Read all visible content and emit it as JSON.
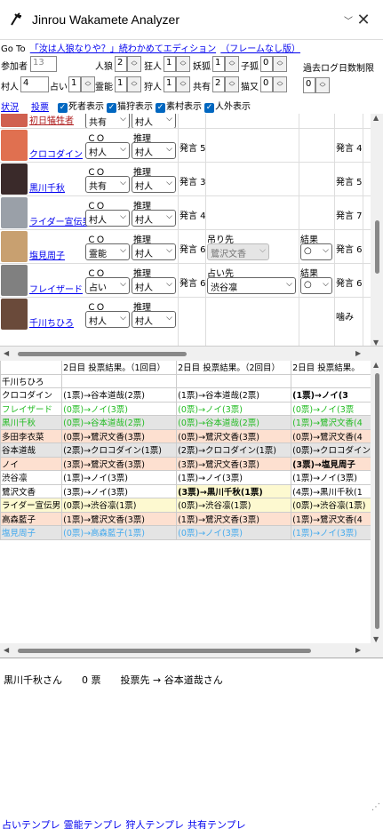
{
  "window": {
    "title": "Jinrou Wakamete Analyzer",
    "chevron": "﹀",
    "close": "✕"
  },
  "goto": {
    "label": "Go To",
    "link1": "「汝は人狼なりや？」続わかめてエディション",
    "link2": "（フレームなし版）"
  },
  "settings": {
    "participants": {
      "label": "参加者",
      "value": "13"
    },
    "wolf": {
      "label": "人狼",
      "value": "2"
    },
    "madman": {
      "label": "狂人",
      "value": "1"
    },
    "fox": {
      "label": "妖狐",
      "value": "1"
    },
    "kitsune_child": {
      "label": "子狐",
      "value": "0"
    },
    "log_limit": {
      "label": "過去ログ日数制限",
      "value": "0"
    },
    "villager": {
      "label": "村人",
      "value": "4"
    },
    "seer": {
      "label": "占い",
      "value": "1"
    },
    "medium": {
      "label": "霊能",
      "value": "1"
    },
    "hunter": {
      "label": "狩人",
      "value": "1"
    },
    "mason": {
      "label": "共有",
      "value": "2"
    },
    "nekomata": {
      "label": "猫又",
      "value": "0"
    }
  },
  "nav": {
    "status": "状況",
    "vote": "投票",
    "opts": [
      "死者表示",
      "猫狩表示",
      "素村表示",
      "人外表示"
    ]
  },
  "players_partial": {
    "name": "初日犠牲者",
    "sel1": "共有",
    "sel2": "村人"
  },
  "players": [
    {
      "name": "クロコダイン",
      "co": "村人",
      "suspect": "村人",
      "col3": "発言 5",
      "col6": "発言 4",
      "color": "#e07050"
    },
    {
      "name": "黒川千秋",
      "co": "共有",
      "suspect": "村人",
      "col3": "発言 3",
      "col6": "発言 5",
      "color": "#3a2a2a"
    },
    {
      "name": "ライダー宣伝男",
      "co": "村人",
      "suspect": "村人",
      "col3": "発言 4",
      "col6": "発言 7",
      "color": "#9aa0a8"
    },
    {
      "name": "塩見周子",
      "co": "霊能",
      "suspect": "村人",
      "col3": "発言 6",
      "col4_label": "吊り先",
      "col4_value": "鷺沢文香",
      "col5_label": "結果",
      "col5_value": "○",
      "col6": "発言 6",
      "color": "#c8a070"
    },
    {
      "name": "フレイザード",
      "co": "占い",
      "suspect": "村人",
      "col3": "発言 6",
      "col4_label": "占い先",
      "col4_value": "渋谷凛",
      "col5_label": "結果",
      "col5_value": "○",
      "col6": "発言 6",
      "color": "#808080"
    },
    {
      "name": "千川ちひろ",
      "co": "村人",
      "suspect": "村人",
      "col3": "",
      "col6": "噛み",
      "color": "#6a4a3a"
    }
  ],
  "labels": {
    "co": "ＣＯ",
    "suspect": "推理"
  },
  "vote_table": {
    "headers": [
      "",
      "2日目 投票結果。（1回目）",
      "2日目 投票結果。（2回目）",
      "2日目 投票結果。"
    ],
    "rows": [
      {
        "name": "千川ちひろ",
        "c1": "",
        "c2": "",
        "c3": "",
        "color": "#000",
        "bg": "#ffffff"
      },
      {
        "name": "クロコダイン",
        "c1": "(1票)→谷本道哉(2票)",
        "c2": "(1票)→谷本道哉(2票)",
        "c3": "(1票)→ノイ(3",
        "color": "#000",
        "bg": "#ffffff",
        "bold3": true
      },
      {
        "name": "フレイザード",
        "c1": "(0票)→ノイ(3票)",
        "c2": "(0票)→ノイ(3票)",
        "c3": "(0票)→ノイ(3票",
        "color": "#22bb22",
        "bg": "#ffffff"
      },
      {
        "name": "黒川千秋",
        "c1": "(0票)→谷本道哉(2票)",
        "c2": "(0票)→谷本道哉(2票)",
        "c3": "(1票)→鷺沢文香(4",
        "color": "#22bb22",
        "bg": "#e4e4e4"
      },
      {
        "name": "多田李衣菜",
        "c1": "(0票)→鷺沢文香(3票)",
        "c2": "(0票)→鷺沢文香(3票)",
        "c3": "(0票)→鷺沢文香(4",
        "color": "#000",
        "bg": "#fde0d0"
      },
      {
        "name": "谷本道哉",
        "c1": "(2票)→クロコダイン(1票)",
        "c2": "(2票)→クロコダイン(1票)",
        "c3": "(0票)→クロコダイン(1",
        "color": "#000",
        "bg": "#e4e4e4"
      },
      {
        "name": "ノイ",
        "c1": "(3票)→鷺沢文香(3票)",
        "c2": "(3票)→鷺沢文香(3票)",
        "c3": "(3票)→塩見周子",
        "color": "#000",
        "bg": "#fde0d0",
        "bold3": true
      },
      {
        "name": "渋谷凛",
        "c1": "(1票)→ノイ(3票)",
        "c2": "(1票)→ノイ(3票)",
        "c3": "(1票)→ノイ(3票)",
        "color": "#000",
        "bg": "#ffffff"
      },
      {
        "name": "鷺沢文香",
        "c1": "(3票)→ノイ(3票)",
        "c2": "(3票)→黒川千秋(1票)",
        "c3": "(4票)→黒川千秋(1",
        "color": "#000",
        "bg": "#ffffff",
        "bold2": true
      },
      {
        "name": "ライダー宣伝男",
        "c1": "(0票)→渋谷凛(1票)",
        "c2": "(0票)→渋谷凛(1票)",
        "c3": "(0票)→渋谷凛(1票)",
        "color": "#000",
        "bg": "#fdf9d0"
      },
      {
        "name": "高森藍子",
        "c1": "(1票)→鷺沢文香(3票)",
        "c2": "(1票)→鷺沢文香(3票)",
        "c3": "(1票)→鷺沢文香(4",
        "color": "#000",
        "bg": "#fde0d0"
      },
      {
        "name": "塩見周子",
        "c1": "(0票)→高森藍子(1票)",
        "c2": "(0票)→ノイ(3票)",
        "c3": "(1票)→ノイ(3票)",
        "color": "#44aaee",
        "bg": "#e4e4e4"
      }
    ]
  },
  "memo": {
    "text": "黒川千秋さん　　0 票　　投票先 → 谷本道哉さん"
  },
  "footer": {
    "links": [
      "占いテンプレ",
      "霊能テンプレ",
      "狩人テンプレ",
      "共有テンプレ"
    ]
  },
  "colors": {
    "link": "#0000ee",
    "accent": "#0067c0"
  }
}
